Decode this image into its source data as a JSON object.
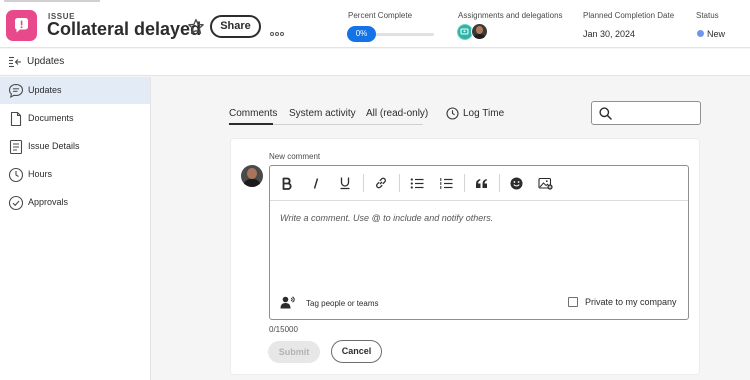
{
  "colors": {
    "brand_pink": "#e8498a",
    "accent_blue": "#1473e6",
    "status_new": "#6f96ef",
    "active_nav_bg": "#e2ebf6"
  },
  "header": {
    "type_label": "ISSUE",
    "title": "Collateral delayed",
    "share_label": "Share",
    "percent_complete": {
      "label": "Percent Complete",
      "value": "0%",
      "fraction": 0
    },
    "assignments": {
      "label": "Assignments and delegations"
    },
    "planned_completion": {
      "label": "Planned Completion Date",
      "value": "Jan 30, 2024"
    },
    "status": {
      "label": "Status",
      "value": "New"
    }
  },
  "section": {
    "title": "Updates"
  },
  "sidebar": {
    "items": [
      {
        "label": "Updates",
        "icon": "comment-bubble-icon",
        "active": true
      },
      {
        "label": "Documents",
        "icon": "document-icon",
        "active": false
      },
      {
        "label": "Issue Details",
        "icon": "details-list-icon",
        "active": false
      },
      {
        "label": "Hours",
        "icon": "clock-icon",
        "active": false
      },
      {
        "label": "Approvals",
        "icon": "check-circle-icon",
        "active": false
      }
    ]
  },
  "tabs": [
    {
      "label": "Comments",
      "active": true
    },
    {
      "label": "System activity",
      "active": false
    },
    {
      "label": "All (read-only)",
      "active": false
    }
  ],
  "log_time": {
    "label": "Log Time"
  },
  "comment": {
    "label": "New comment",
    "placeholder": "Write a comment. Use @ to include and notify others.",
    "toolbar": [
      "bold",
      "italic",
      "underline",
      "link",
      "bulleted-list",
      "numbered-list",
      "quote",
      "emoji",
      "insert-image"
    ],
    "tag_label": "Tag people or teams",
    "private_label": "Private to my company",
    "private_checked": false,
    "counter": "0/15000",
    "submit_label": "Submit",
    "cancel_label": "Cancel"
  }
}
